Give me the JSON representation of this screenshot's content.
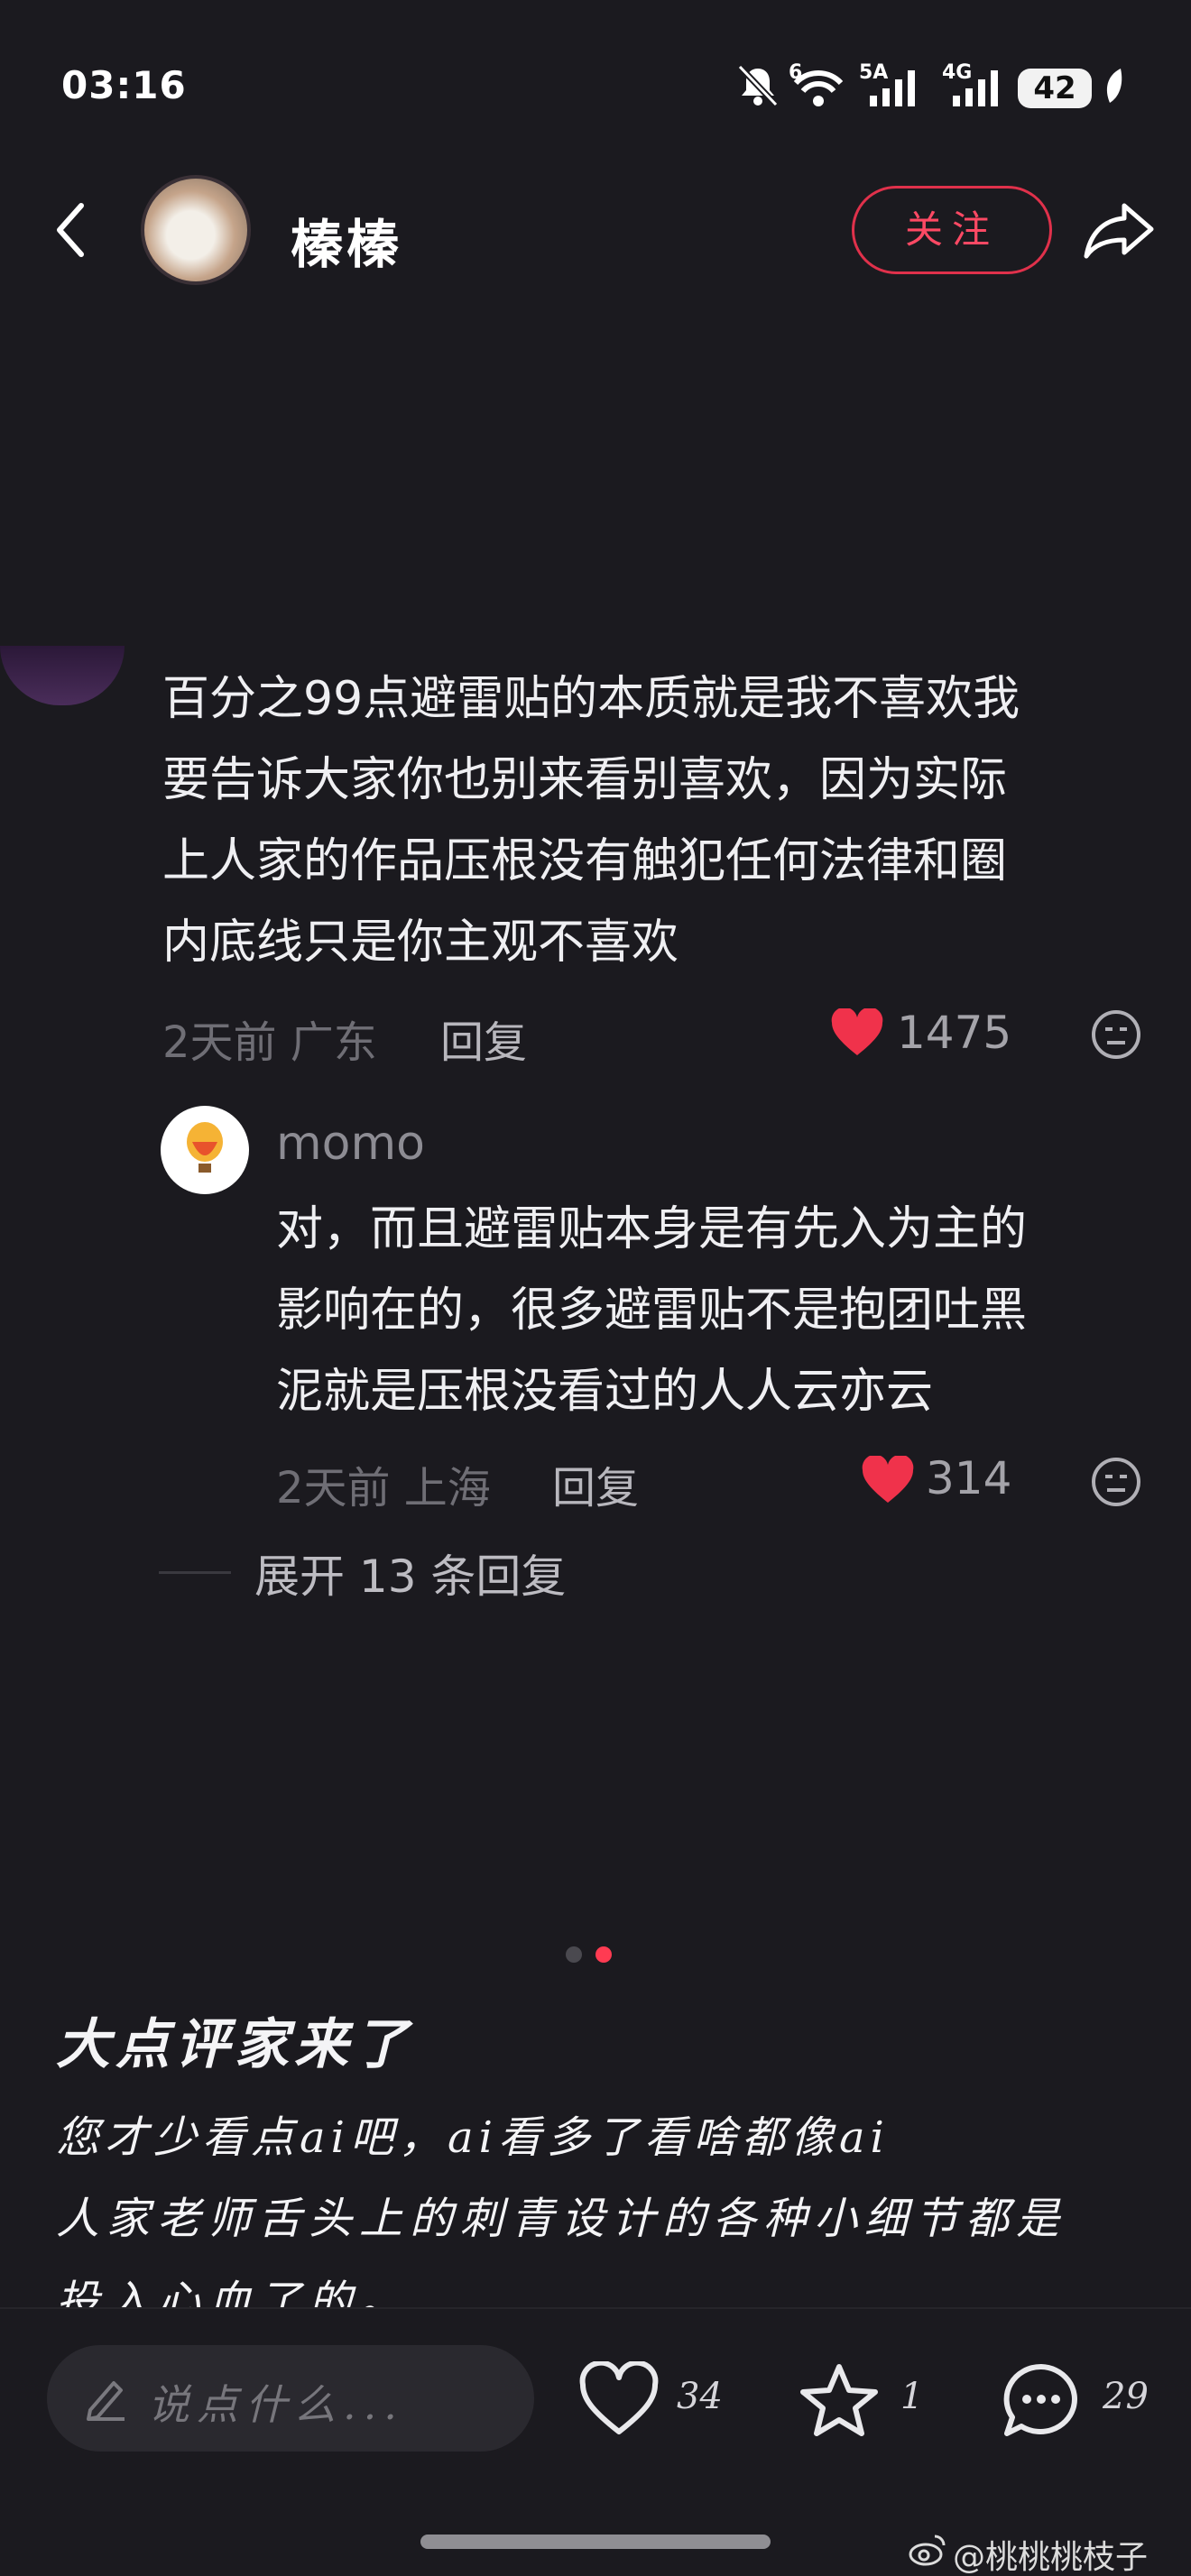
{
  "status_bar": {
    "time": "03:16",
    "battery": "42",
    "network_1": "5A",
    "network_2": "4G",
    "wifi_badge": "6"
  },
  "header": {
    "username": "榛榛",
    "follow_label": "关注"
  },
  "comment": {
    "lines": [
      "百分之99点避雷贴的本质就是我不喜欢我",
      "要告诉大家你也别来看别喜欢，因为实际",
      "上人家的作品压根没有触犯任何法律和圈",
      "内底线只是你主观不喜欢"
    ],
    "time_location": "2天前 广东",
    "reply_label": "回复",
    "likes": "1475"
  },
  "reply": {
    "name": "momo",
    "lines": [
      "对，而且避雷贴本身是有先入为主的",
      "影响在的，很多避雷贴不是抱团吐黑",
      "泥就是压根没看过的人人云亦云"
    ],
    "time_location": "2天前 上海",
    "reply_label": "回复",
    "likes": "314"
  },
  "expand_label": "展开 13 条回复",
  "post": {
    "title": "大点评家来了",
    "line1": "您才少看点ai吧，ai看多了看啥都像ai",
    "line2": "人家老师舌头上的刺青设计的各种小细节都是",
    "line3": "投入心血了的。"
  },
  "bottom_bar": {
    "input_placeholder": "说点什么...",
    "like_count": "34",
    "fav_count": "1",
    "comment_count": "29"
  },
  "watermark": "@桃桃桃枝子",
  "colors": {
    "accent": "#ff3b52",
    "background": "#1b1a1f"
  }
}
